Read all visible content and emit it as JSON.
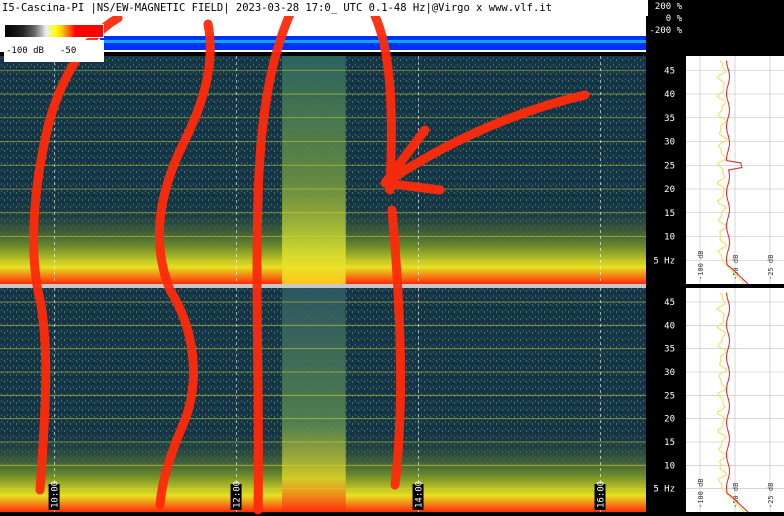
{
  "header": {
    "title": "I5-Cascina-PI |NS/EW-MAGNETIC FIELD| 2023-03-28 17:0_ UTC 0.1-48 Hz|@Virgo x www.vlf.it"
  },
  "amplitude_scale": [
    "200 %",
    "0 %",
    "-200 %"
  ],
  "color_scale": {
    "min_label": "-100 dB",
    "mid_label": "-50"
  },
  "colors": {
    "annotation": "#ff2a0a",
    "gridline": "#d8d030",
    "profile": "#f2e27a",
    "profile_peak": "#e0303a"
  },
  "chart_data": [
    {
      "type": "heatmap",
      "panel": "NS magnetic field spectrogram (top)",
      "ylabel": "Hz",
      "y_ticks": [
        5,
        10,
        15,
        20,
        25,
        30,
        35,
        40,
        45
      ],
      "ylim": [
        0,
        48
      ],
      "time_labels": [
        "10:00",
        "12:00",
        "14:00",
        "16:00"
      ],
      "time_label_positions_hours": [
        10,
        12,
        14,
        16
      ],
      "time_range_hours": [
        9.4,
        16.5
      ],
      "grid": true,
      "features": [
        {
          "label": "wideband burst",
          "start_hour": 12.5,
          "end_hour": 13.2,
          "fmax_hz": 48
        }
      ]
    },
    {
      "type": "heatmap",
      "panel": "EW magnetic field spectrogram (bottom)",
      "ylabel": "Hz",
      "y_ticks": [
        5,
        10,
        15,
        20,
        25,
        30,
        35,
        40,
        45
      ],
      "ylim": [
        0,
        48
      ],
      "time_labels": [
        "10:00",
        "12:00",
        "14:00",
        "16:00"
      ],
      "time_label_positions_hours": [
        10,
        12,
        14,
        16
      ],
      "time_range_hours": [
        9.4,
        16.5
      ],
      "grid": true
    },
    {
      "type": "line",
      "panel": "average spectrum profile (top right)",
      "x_ticks": [
        "-100 dB",
        "-50 dB",
        "-25 dB"
      ],
      "ylim": [
        0,
        48
      ],
      "peaks_hz": [
        25
      ]
    },
    {
      "type": "line",
      "panel": "average spectrum profile (bottom right)",
      "x_ticks": [
        "-100 dB",
        "-50 dB",
        "-25 dB"
      ],
      "ylim": [
        0,
        48
      ]
    }
  ]
}
